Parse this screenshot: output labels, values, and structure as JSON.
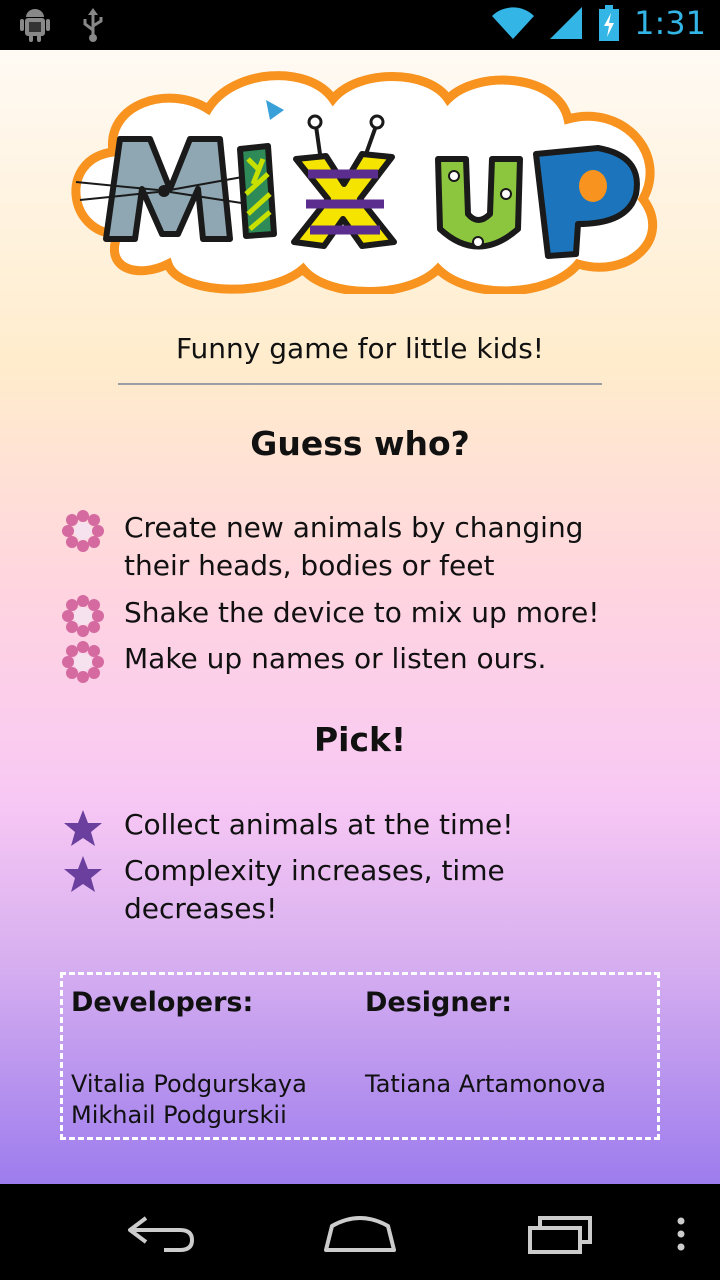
{
  "status_bar": {
    "time": "1:31",
    "icons": [
      "android-debug-icon",
      "usb-icon",
      "wifi-icon",
      "cell-signal-icon",
      "battery-charging-icon"
    ]
  },
  "logo": {
    "text": "MiX UP"
  },
  "tagline": "Funny game for little kids!",
  "sections": {
    "guess": {
      "heading": "Guess who?",
      "items": [
        "Create new animals by changing their heads, bodies or feet",
        "Shake the device to mix up more!",
        "Make up names or listen ours."
      ]
    },
    "pick": {
      "heading": "Pick!",
      "items": [
        "Collect animals at the time!",
        "Complexity increases, time decreases!"
      ]
    }
  },
  "credits": {
    "developers_label": "Developers:",
    "developers": [
      "Vitalia Podgurskaya",
      "Mikhail Podgurskii"
    ],
    "designer_label": "Designer:",
    "designer": "Tatiana Artamonova"
  },
  "colors": {
    "status_accent": "#33b5e5",
    "flower_bullet": "#d46aa0",
    "star_bullet": "#6a3f9e",
    "logo_outline": "#f7931e"
  }
}
